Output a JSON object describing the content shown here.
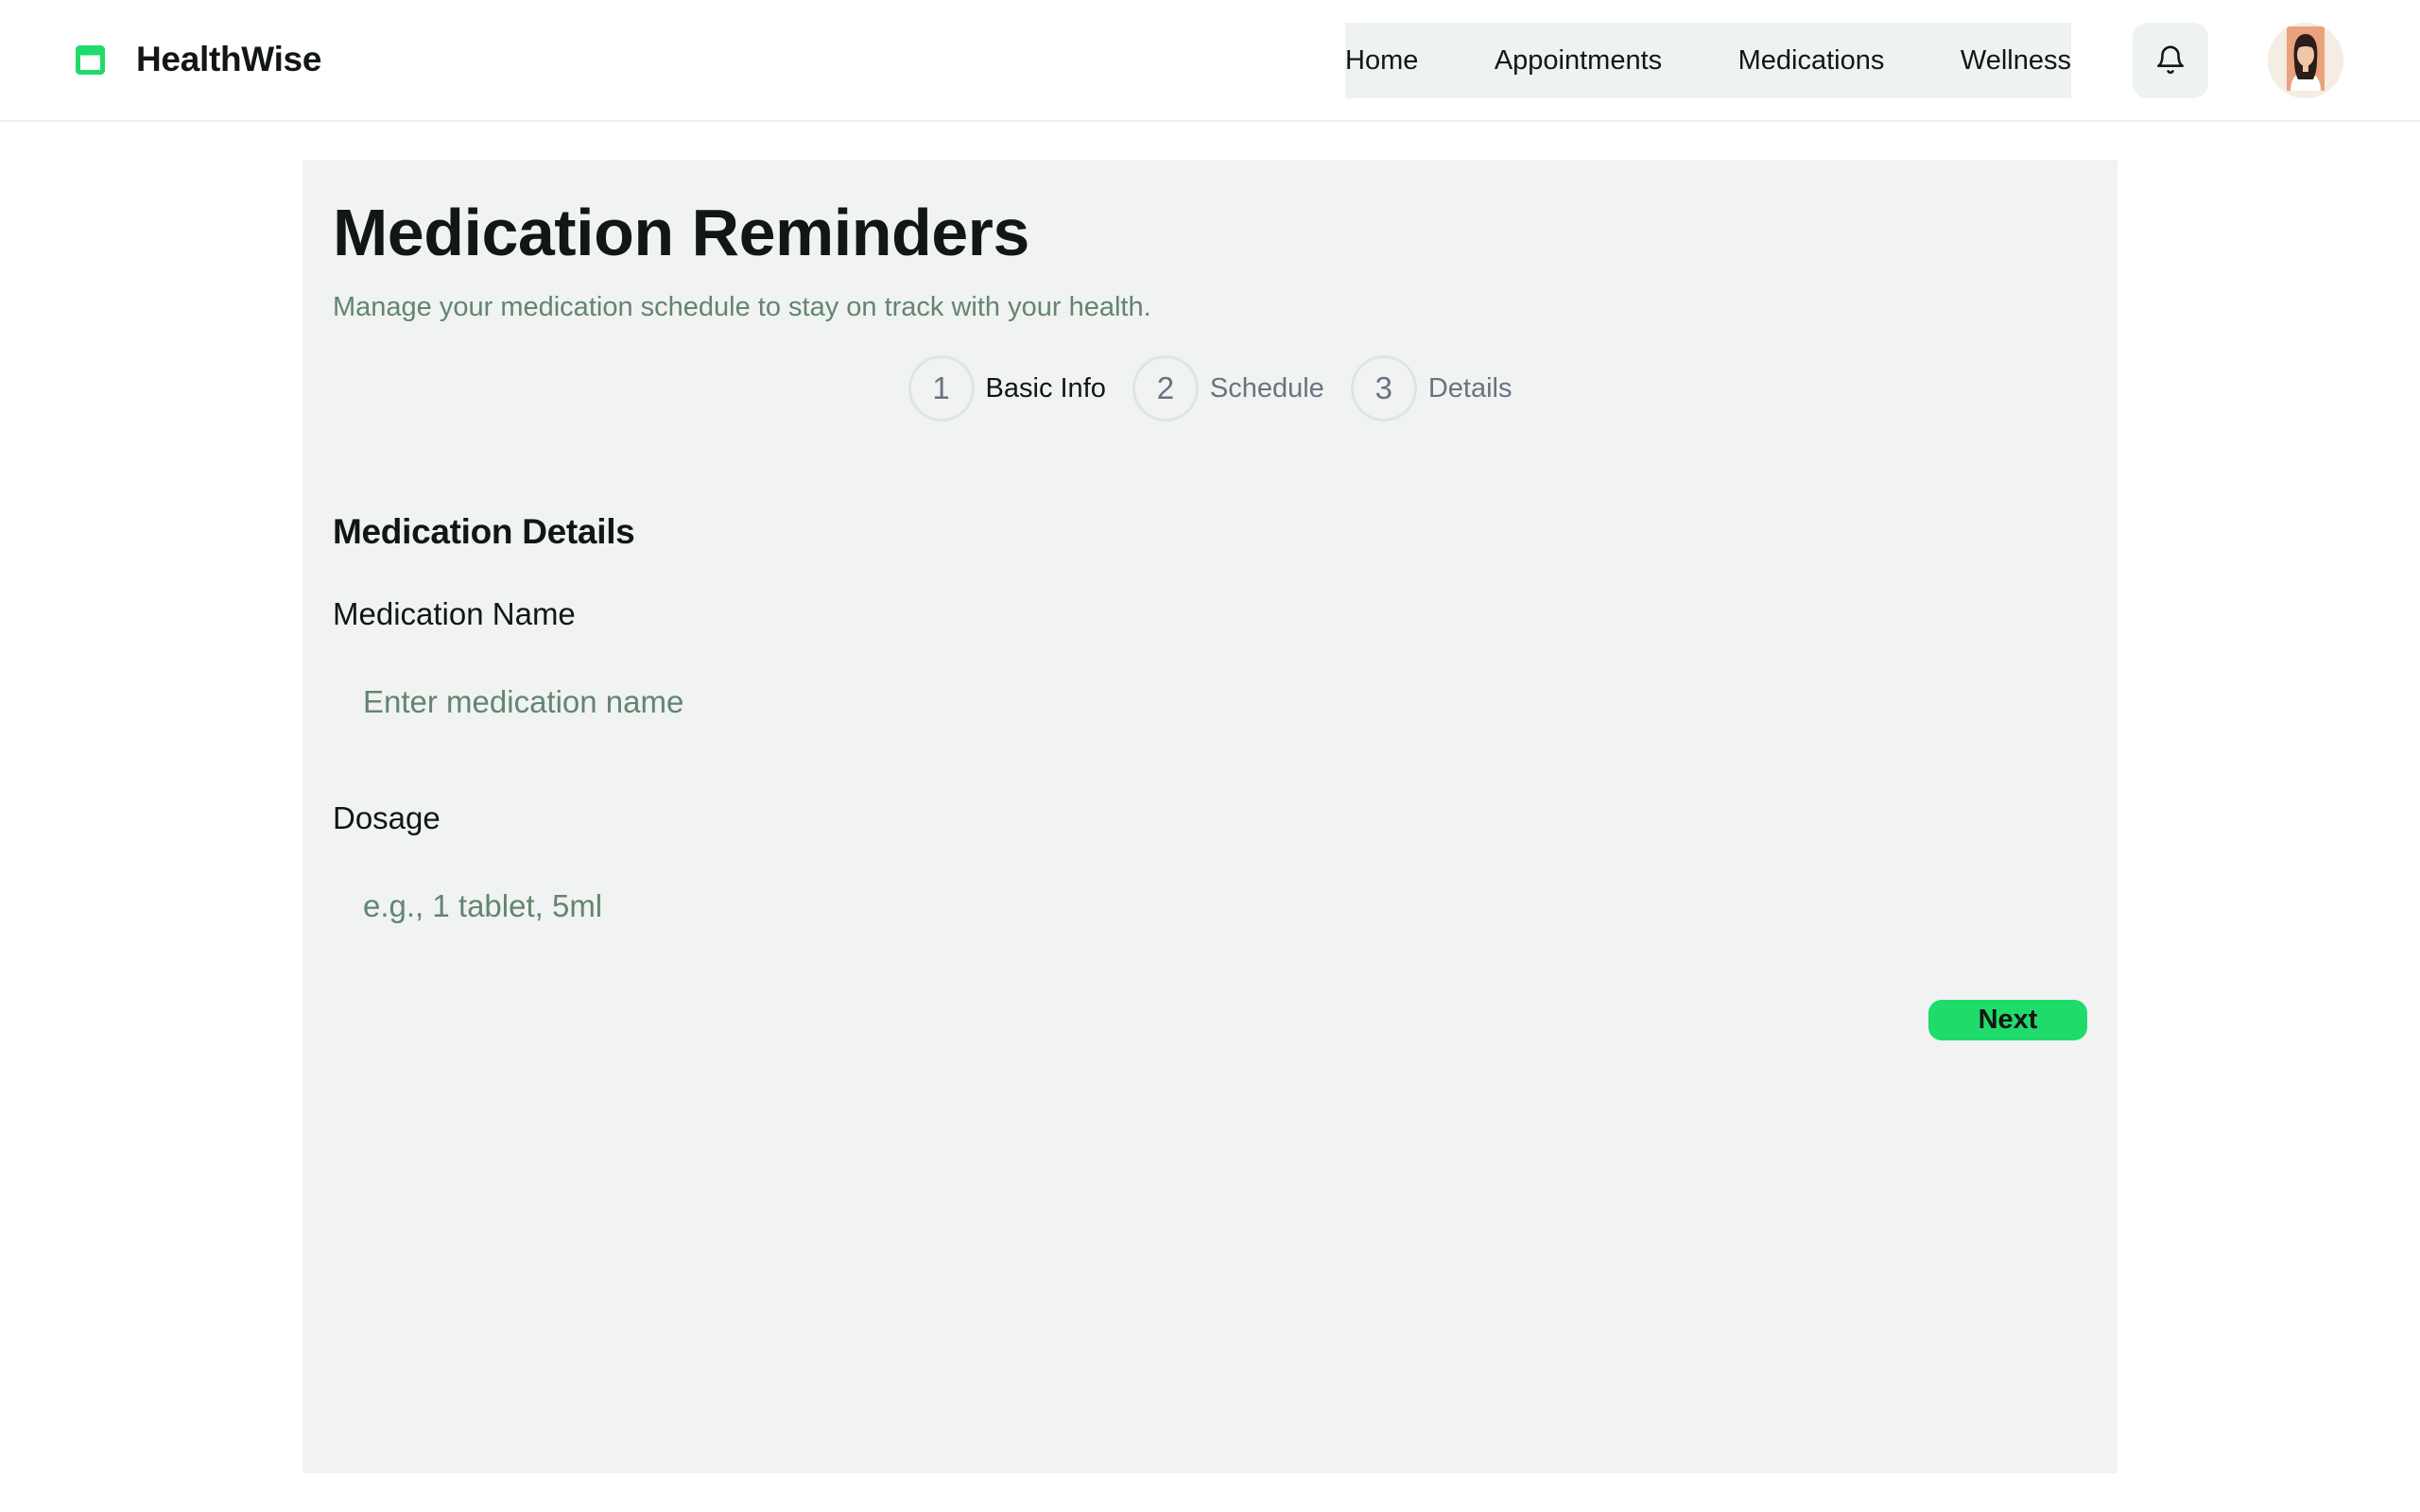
{
  "header": {
    "brand": "HealthWise",
    "logo_icon": "pill-box-icon",
    "nav": [
      "Home",
      "Appointments",
      "Medications",
      "Wellness"
    ],
    "notification_icon": "bell-icon",
    "avatar_icon": "user-avatar"
  },
  "main": {
    "title": "Medication Reminders",
    "subtitle": "Manage your medication schedule to stay on track with your health.",
    "steps": [
      {
        "number": "1",
        "label": "Basic Info"
      },
      {
        "number": "2",
        "label": "Schedule"
      },
      {
        "number": "3",
        "label": "Details"
      }
    ],
    "active_step": 1,
    "section_title": "Medication Details",
    "form": {
      "medication_name_label": "Medication Name",
      "medication_name_value": "",
      "medication_name_placeholder": "Enter medication name",
      "dosage_label": "Dosage",
      "dosage_value": "",
      "dosage_placeholder": "e.g., 1 tablet, 5ml"
    },
    "next_label": "Next"
  },
  "colors": {
    "accent": "#1fdb6b",
    "panel_bg": "#f0f3f2",
    "muted_text": "#638570",
    "text": "#121714"
  }
}
